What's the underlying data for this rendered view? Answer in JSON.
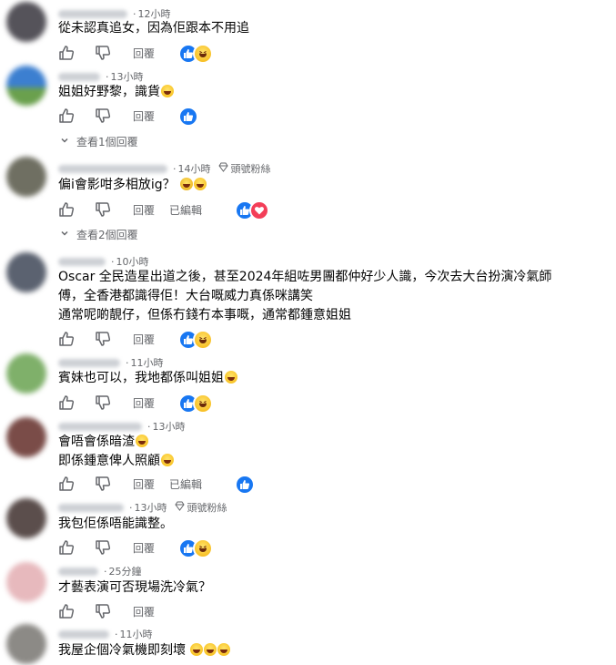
{
  "actions": {
    "reply_label": "回覆",
    "edited_label": "已編輯"
  },
  "comments": [
    {
      "time": "12小時",
      "text": "從未認真追女，因為佢跟本不用追"
    },
    {
      "time": "13小時",
      "text": "姐姐好野黎，識貨"
    },
    {
      "time": "14小時",
      "badge": "頭號粉絲",
      "text": "偏i會影咁多相放ig？"
    },
    {
      "time": "10小時",
      "lines": [
        "Oscar 全民造星出道之後，甚至2024年組咗男團都仲好少人識，今次去大台扮演冷氣師",
        "傅，全香港都識得佢！大台嘅威力真係咪講笑",
        "通常呢啲靚仔，但係冇錢冇本事嘅，通常都鍾意姐姐"
      ]
    },
    {
      "time": "11小時",
      "text": "賓妹也可以，我地都係叫姐姐"
    },
    {
      "time": "13小時",
      "lines": [
        "會唔會係暗渣",
        "即係鍾意俾人照顧"
      ]
    },
    {
      "time": "13小時",
      "badge": "頭號粉絲",
      "text": "我包佢係唔能識整。"
    },
    {
      "time": "25分鐘",
      "text": "才藝表演可否現場洗冷氣？"
    },
    {
      "time": "11小時",
      "text": "我屋企個冷氣機即刻壞"
    }
  ],
  "view_replies": [
    "查看1個回覆",
    "查看2個回覆"
  ],
  "icons": {
    "like": "thumbs-up-icon",
    "dislike": "thumbs-down-icon",
    "badge": "diamond-icon"
  },
  "colors": {
    "like_blue": "#1877f2",
    "love_red": "#f33e58",
    "meta_gray": "#65676b"
  }
}
